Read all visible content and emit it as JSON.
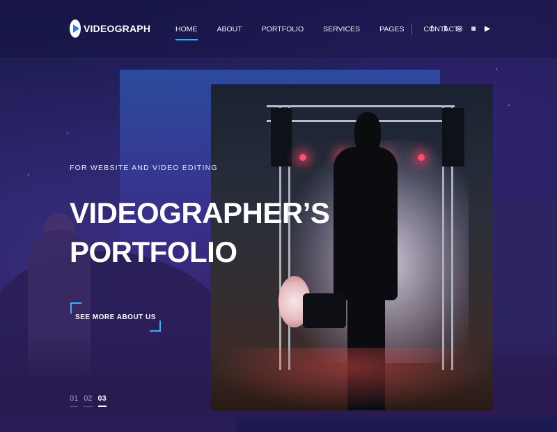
{
  "brand": {
    "name": "VIDEOGRAPH",
    "logo_icon": "play-icon",
    "accent": "#26b7ff"
  },
  "nav": {
    "items": [
      "HOME",
      "ABOUT",
      "PORTFOLIO",
      "SERVICES",
      "PAGES",
      "CONTACT"
    ],
    "active": "HOME"
  },
  "social": [
    {
      "icon": "facebook-icon",
      "glyph": "f"
    },
    {
      "icon": "twitter-icon",
      "glyph": "𝕥"
    },
    {
      "icon": "dribbble-icon",
      "glyph": "◎"
    },
    {
      "icon": "instagram-icon",
      "glyph": "◙"
    },
    {
      "icon": "youtube-icon",
      "glyph": "▶"
    }
  ],
  "hero": {
    "tagline": "FOR WEBSITE AND VIDEO EDITING",
    "title_line1": "VIDEOGRAPHER’S",
    "title_line2": "PORTFOLIO",
    "cta_label": "SEE MORE ABOUT US"
  },
  "pager": {
    "pages": [
      "01",
      "02",
      "03"
    ],
    "active": "03"
  }
}
